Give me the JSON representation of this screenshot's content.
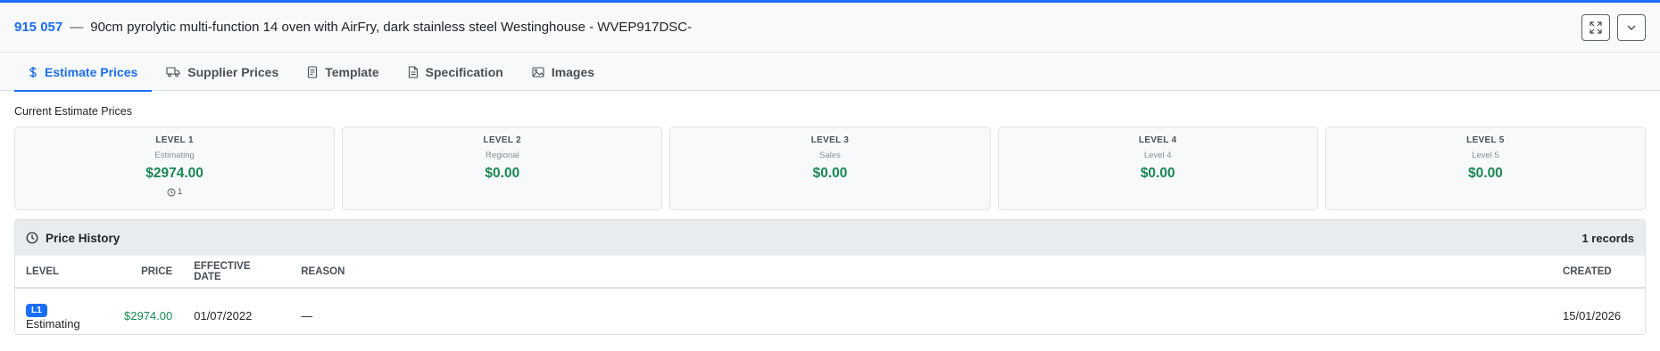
{
  "header": {
    "code": "915 057",
    "separator": "—",
    "title": "90cm pyrolytic multi-function 14 oven with AirFry, dark stainless steel Westinghouse - WVEP917DSC-",
    "expand_icon": "expand-icon",
    "collapse_icon": "chevron-down-icon"
  },
  "tabs": [
    {
      "label": "Estimate Prices",
      "icon": "dollar-icon",
      "active": true
    },
    {
      "label": "Supplier Prices",
      "icon": "truck-icon",
      "active": false
    },
    {
      "label": "Template",
      "icon": "document-icon",
      "active": false
    },
    {
      "label": "Specification",
      "icon": "file-text-icon",
      "active": false
    },
    {
      "label": "Images",
      "icon": "image-icon",
      "active": false
    }
  ],
  "current_prices_label": "Current Estimate Prices",
  "levels": [
    {
      "level": "LEVEL 1",
      "name": "Estimating",
      "amount": "$2974.00",
      "count": "1"
    },
    {
      "level": "LEVEL 2",
      "name": "Regional",
      "amount": "$0.00"
    },
    {
      "level": "LEVEL 3",
      "name": "Sales",
      "amount": "$0.00"
    },
    {
      "level": "LEVEL 4",
      "name": "Level 4",
      "amount": "$0.00"
    },
    {
      "level": "LEVEL 5",
      "name": "Level 5",
      "amount": "$0.00"
    }
  ],
  "history": {
    "title": "Price History",
    "records": "1 records",
    "columns": {
      "level": "LEVEL",
      "price": "PRICE",
      "effective": "EFFECTIVE DATE",
      "reason": "REASON",
      "created": "CREATED"
    },
    "rows": [
      {
        "badge": "L1",
        "level_name": "Estimating",
        "price": "$2974.00",
        "effective": "01/07/2022",
        "reason": "—",
        "created": "15/01/2026"
      }
    ]
  },
  "colors": {
    "accent": "#1a6ef5",
    "price_green": "#198754"
  }
}
